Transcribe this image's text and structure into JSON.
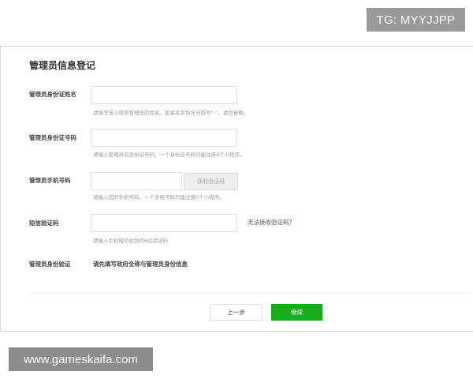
{
  "watermarks": {
    "tg": "TG: MYYJJPP",
    "site": "www.gameskaifa.com"
  },
  "form": {
    "title": "管理员信息登记",
    "fields": [
      {
        "label": "管理员身份证姓名",
        "value": "",
        "hint": "请填写该小程序管理员的姓名。如果名字包含分隔号“·”，请勿省略。"
      },
      {
        "label": "管理员身份证号码",
        "value": "",
        "hint": "请输入管理员的身份证号码，一个身份证号码只能注册5个小程序。"
      },
      {
        "label": "管理员手机号码",
        "value": "",
        "button": "获取验证码",
        "hint": "请输入您的手机号码，一个手机号码只能注册5个小程序。"
      },
      {
        "label": "短信验证码",
        "value": "",
        "link": "无法接收验证码？",
        "hint": "请输入手机短信收到的6位验证码"
      },
      {
        "label": "管理员身份验证",
        "text": "请先填写政府全称与管理员身份信息"
      }
    ]
  },
  "actions": {
    "prev": "上一步",
    "next": "继续"
  },
  "colors": {
    "primary_green": "#1aad19",
    "hint_gray": "#999999",
    "border_gray": "#e2e2e2"
  }
}
